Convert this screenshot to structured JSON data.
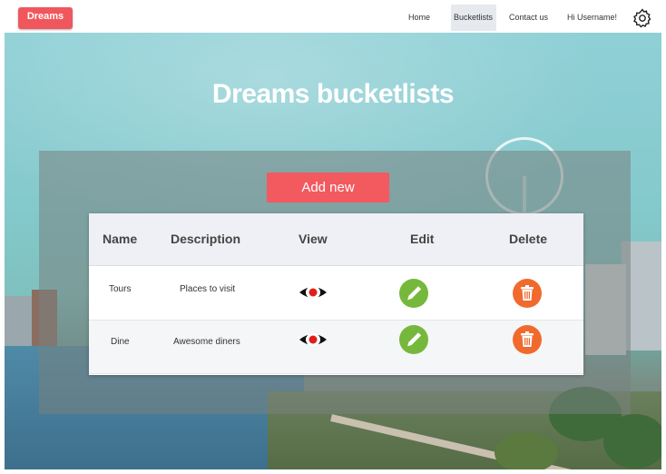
{
  "navbar": {
    "brand": "Dreams",
    "links": [
      "Home",
      "Bucketlists",
      "Contact us",
      "Hi Username!"
    ],
    "active": "Bucketlists"
  },
  "hero": {
    "title": "Dreams bucketlists"
  },
  "actions": {
    "add_new": "Add new"
  },
  "table": {
    "headers": [
      "Name",
      "Description",
      "View",
      "Edit",
      "Delete"
    ],
    "rows": [
      {
        "name": "Tours",
        "description": "Places to visit"
      },
      {
        "name": "Dine",
        "description": "Awesome diners"
      }
    ]
  },
  "icons": {
    "settings": "gear-icon",
    "view": "eye-icon",
    "edit": "pencil-icon",
    "delete": "trash-icon"
  },
  "colors": {
    "accent": "#f0575d",
    "edit": "#76b83c",
    "delete": "#f06a2e"
  }
}
